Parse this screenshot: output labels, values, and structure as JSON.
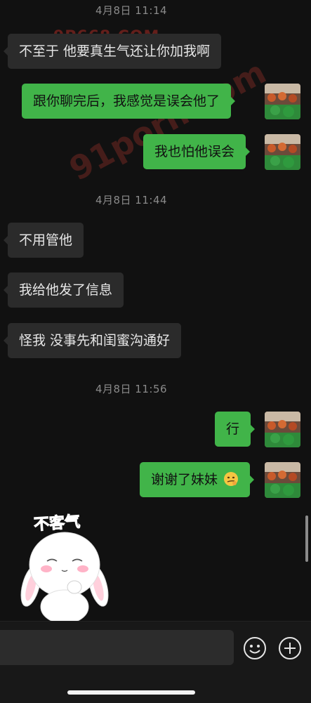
{
  "chat": {
    "timestamps": [
      "4月8日 11:14",
      "4月8日 11:44",
      "4月8日 11:56"
    ],
    "messages": [
      {
        "side": "in",
        "text": "不至于 他要真生气还让你加我啊"
      },
      {
        "side": "out",
        "text": "跟你聊完后，我感觉是误会他了"
      },
      {
        "side": "out",
        "text": "我也怕他误会"
      },
      {
        "side": "in",
        "text": "不用管他"
      },
      {
        "side": "in",
        "text": "我给他发了信息"
      },
      {
        "side": "in",
        "text": "怪我 没事先和闺蜜沟通好"
      },
      {
        "side": "out",
        "text": "行"
      },
      {
        "side": "out",
        "text": "谢谢了妹妹",
        "emoji": "smirk-emoji"
      }
    ],
    "sticker": {
      "caption": "不客气",
      "icon": "bunny-sticker"
    }
  },
  "watermarks": [
    "9P668.COM",
    "91porn.com"
  ],
  "input_bar": {
    "value": "",
    "emoji_icon": "smiley-icon",
    "plus_icon": "plus-circle-icon"
  },
  "colors": {
    "background": "#111111",
    "incoming_bubble": "#2b2b2b",
    "outgoing_bubble": "#41b449",
    "timestamp": "#8a8a8a"
  }
}
